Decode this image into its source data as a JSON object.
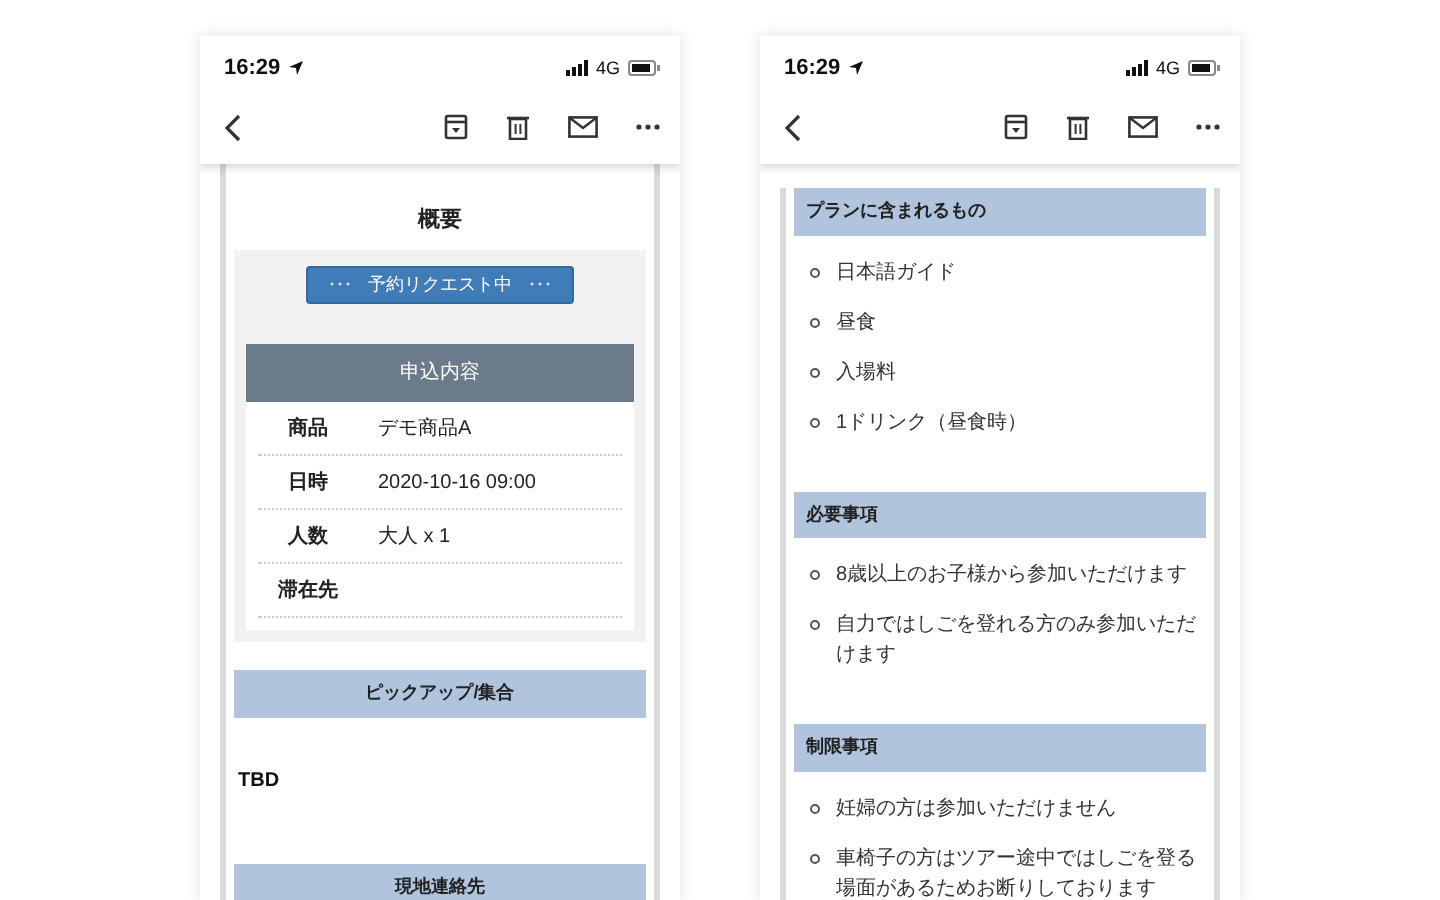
{
  "screens": [
    {
      "status_bar": {
        "time": "16:29",
        "network": "4G"
      },
      "content": {
        "title": "概要",
        "status_button": "予約リクエスト中",
        "details": {
          "header": "申込内容",
          "rows": [
            {
              "label": "商品",
              "value": "デモ商品A"
            },
            {
              "label": "日時",
              "value": "2020-10-16 09:00"
            },
            {
              "label": "人数",
              "value": "大人 x 1"
            },
            {
              "label": "滞在先",
              "value": ""
            }
          ]
        },
        "sections": [
          {
            "kind": "text",
            "heading": "ピックアップ/集合",
            "body": "TBD"
          },
          {
            "kind": "text",
            "heading": "現地連絡先"
          }
        ]
      }
    },
    {
      "status_bar": {
        "time": "16:29",
        "network": "4G"
      },
      "content": {
        "sections": [
          {
            "kind": "list",
            "heading": "プランに含まれるもの",
            "items": [
              "日本語ガイド",
              "昼食",
              "入場料",
              "1ドリンク（昼食時）"
            ]
          },
          {
            "kind": "list",
            "heading": "必要事項",
            "items": [
              "8歳以上のお子様から参加いただけます",
              "自力ではしごを登れる方のみ参加いただけます"
            ]
          },
          {
            "kind": "list",
            "heading": "制限事項",
            "items": [
              "妊婦の方は参加いただけません",
              "車椅子の方はツアー途中ではしごを登る場面があるためお断りしております"
            ]
          }
        ]
      }
    }
  ]
}
